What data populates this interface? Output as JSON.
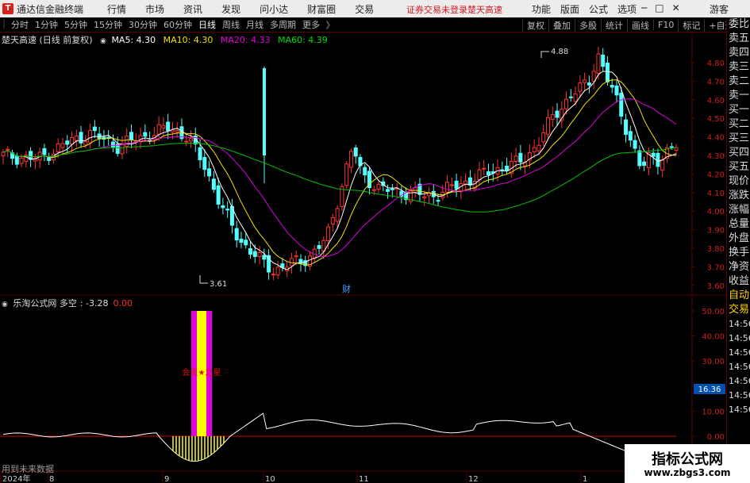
{
  "app": {
    "title": "通达信金融终端",
    "logo": "T"
  },
  "menu": [
    "行情",
    "市场",
    "资讯",
    "发现",
    "问小达",
    "财富圈",
    "交易"
  ],
  "login_warning": "证券交易未登录",
  "stock_link": "楚天高速",
  "right_menu": [
    "功能",
    "版面",
    "公式",
    "选项"
  ],
  "guest": "游客",
  "toolbar": {
    "periods": [
      "分时",
      "1分钟",
      "5分钟",
      "15分钟",
      "30分钟",
      "60分钟",
      "日线",
      "周线",
      "月线",
      "多周期",
      "更多"
    ],
    "active_period": "日线",
    "right": [
      "复权",
      "叠加",
      "多股",
      "统计",
      "画线",
      "F10",
      "标记",
      "+自选",
      "返回"
    ]
  },
  "chart": {
    "title": "楚天高速 (日线 前复权)",
    "ma": {
      "ma5": "MA5: 4.30",
      "ma10": "MA10: 4.30",
      "ma20": "MA20: 4.33",
      "ma60": "MA60: 4.39"
    },
    "high_label": "4.88",
    "low_label": "3.61",
    "finance_marker": "财",
    "y_labels": [
      "4.80",
      "4.70",
      "4.60",
      "4.50",
      "4.40",
      "4.30",
      "4.20",
      "4.10",
      "4.00",
      "3.90",
      "3.80",
      "3.70",
      "3.60"
    ],
    "x_labels": [
      "2024年",
      "8",
      "9",
      "10",
      "11",
      "12",
      "1"
    ]
  },
  "indicator": {
    "name": "乐淘公式网 多空",
    "value": ": -3.28",
    "value2": "0.00",
    "y_labels": [
      "50.00",
      "40.00",
      "30.00",
      "20.00",
      "10.00",
      "0.00"
    ],
    "current_value": "16.36",
    "annotation": "会员★之星",
    "caution": "用到未来数据"
  },
  "side_panel": {
    "items": [
      "委比",
      "卖五",
      "卖四",
      "卖三",
      "卖二",
      "卖一",
      "买一",
      "买二",
      "买三",
      "买四",
      "买五",
      "现价",
      "涨跌",
      "涨幅",
      "总量",
      "外盘",
      "换手",
      "净资",
      "收益",
      "自动",
      "交易"
    ],
    "highlight": [
      "自动",
      "交易"
    ],
    "times": [
      "14:56",
      "14:56",
      "14:56",
      "14:56",
      "14:56",
      "14:56",
      "14:56"
    ]
  },
  "watermark": {
    "title": "指标公式网",
    "url": "www.zbgs3.com"
  },
  "colors": {
    "up": "#ff3232",
    "down": "#54ffff",
    "ma5": "#ffffff",
    "ma10": "#f0e100",
    "ma20": "#e000e0",
    "ma60": "#00c000",
    "grid": "#5a0000"
  }
}
